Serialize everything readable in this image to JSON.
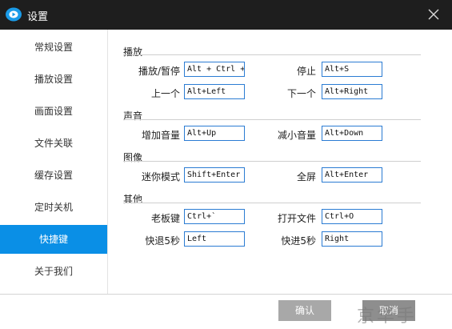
{
  "window": {
    "title": "设置"
  },
  "sidebar": {
    "items": [
      {
        "label": "常规设置"
      },
      {
        "label": "播放设置"
      },
      {
        "label": "画面设置"
      },
      {
        "label": "文件关联"
      },
      {
        "label": "缓存设置"
      },
      {
        "label": "定时关机"
      },
      {
        "label": "快捷键",
        "active": true
      },
      {
        "label": "关于我们"
      }
    ]
  },
  "sections": {
    "playback": {
      "title": "播放",
      "play_pause": {
        "label": "播放/暂停",
        "value": "Alt + Ctrl + "
      },
      "stop": {
        "label": "停止",
        "value": "Alt+S"
      },
      "previous": {
        "label": "上一个",
        "value": "Alt+Left"
      },
      "next": {
        "label": "下一个",
        "value": "Alt+Right"
      }
    },
    "sound": {
      "title": "声音",
      "volume_up": {
        "label": "增加音量",
        "value": "Alt+Up"
      },
      "volume_down": {
        "label": "减小音量",
        "value": "Alt+Down"
      }
    },
    "image": {
      "title": "图像",
      "mini_mode": {
        "label": "迷你模式",
        "value": "Shift+Enter"
      },
      "fullscreen": {
        "label": "全屏",
        "value": "Alt+Enter"
      }
    },
    "other": {
      "title": "其他",
      "boss_key": {
        "label": "老板键",
        "value": "Ctrl+`"
      },
      "open_file": {
        "label": "打开文件",
        "value": "Ctrl+O"
      },
      "rewind_5s": {
        "label": "快退5秒",
        "value": "Left"
      },
      "forward_5s": {
        "label": "快进5秒",
        "value": "Right"
      }
    }
  },
  "footer": {
    "ok_label": "确认",
    "cancel_label": "取消",
    "watermark": "京华手"
  },
  "colors": {
    "titlebar": "#1e1e1e",
    "accent": "#0a8fe6",
    "input_border": "#2b7cd3"
  }
}
